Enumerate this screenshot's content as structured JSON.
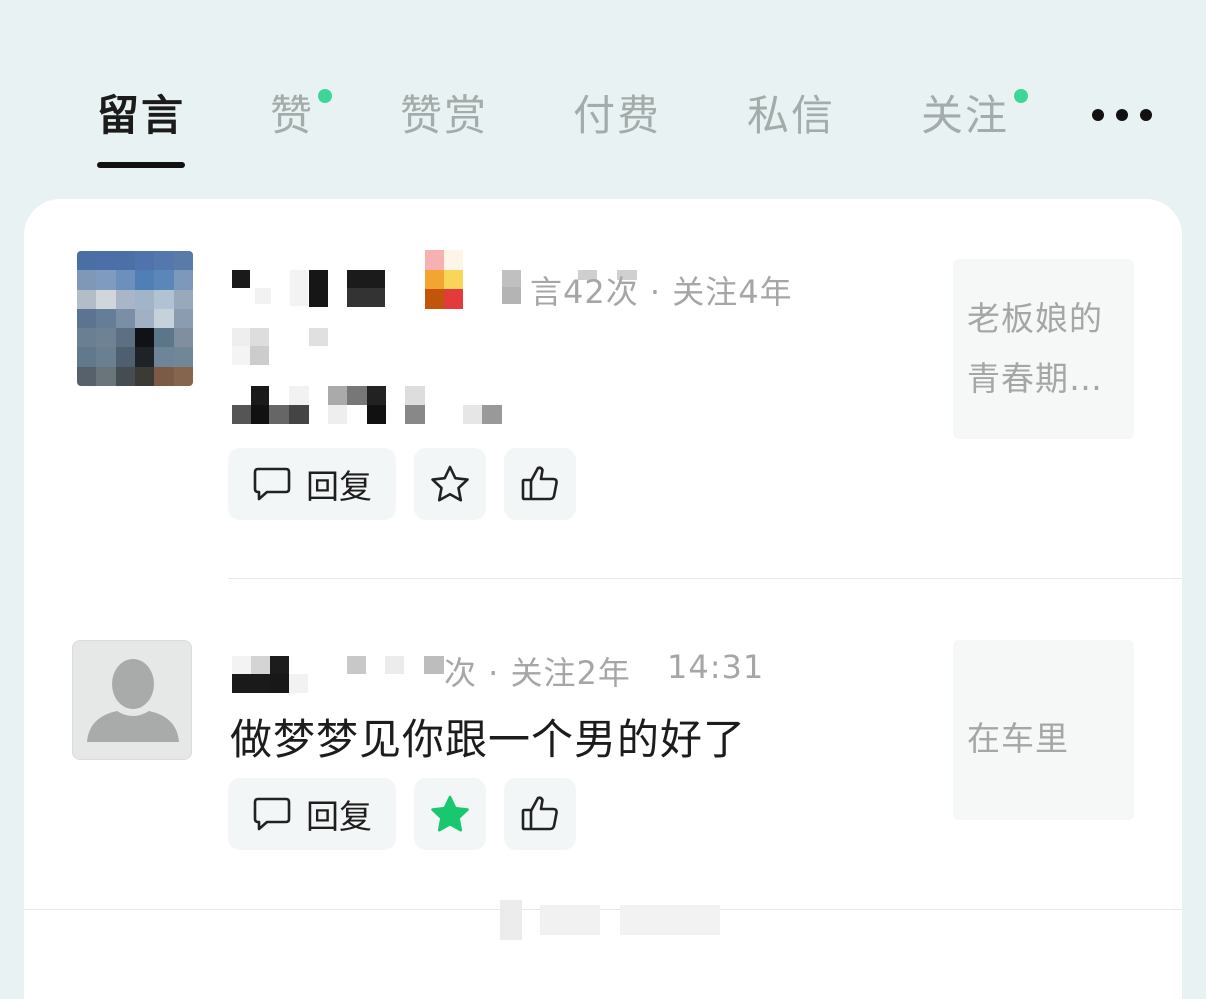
{
  "tabs": [
    {
      "label": "留言",
      "active": true
    },
    {
      "label": "赞",
      "active": false,
      "badge": true
    },
    {
      "label": "赞赏",
      "active": false
    },
    {
      "label": "付费",
      "active": false
    },
    {
      "label": "私信",
      "active": false
    },
    {
      "label": "关注",
      "active": false,
      "badge": true
    }
  ],
  "more_icon": "more-horizontal-icon",
  "comments": [
    {
      "meta": "言42次 · 关注4年",
      "text": "",
      "reply_label": "回复",
      "starred": false,
      "article_title": "老板娘的\n青春期…",
      "article_line1": "老板娘的",
      "article_line2": "青春期…"
    },
    {
      "meta": "次 · 关注2年",
      "time": "14:31",
      "text": "做梦梦见你跟一个男的好了",
      "reply_label": "回复",
      "starred": true,
      "article_title": "在车里"
    }
  ],
  "colors": {
    "background": "#e8f2f2",
    "card": "#ffffff",
    "badge": "#3ed598",
    "star_active": "#19c86e",
    "button_bg": "#f3f6f6"
  }
}
